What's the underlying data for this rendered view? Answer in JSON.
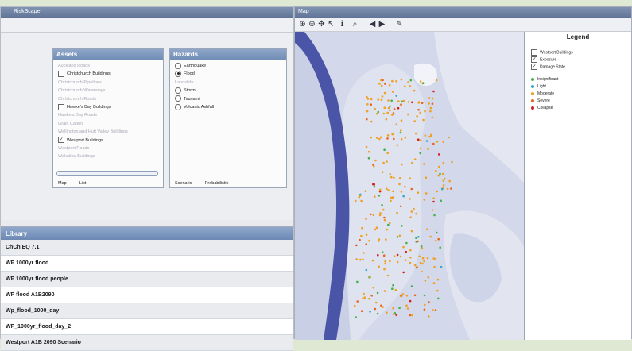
{
  "left_window": {
    "title": "RiskScape"
  },
  "assets": {
    "title": "Assets",
    "items": [
      {
        "label": "Auckland Roads",
        "checked": false,
        "enabled": false
      },
      {
        "label": "Christchurch Buildings",
        "checked": false,
        "enabled": true
      },
      {
        "label": "Christchurch Pipelines",
        "checked": false,
        "enabled": false
      },
      {
        "label": "Christchurch Waterways",
        "checked": false,
        "enabled": false
      },
      {
        "label": "Christchurch Roads",
        "checked": false,
        "enabled": false
      },
      {
        "label": "Hawke's Bay Buildings",
        "checked": false,
        "enabled": true
      },
      {
        "label": "Hawke's Bay Roads",
        "checked": false,
        "enabled": false
      },
      {
        "label": "Grain Cables",
        "checked": false,
        "enabled": false
      },
      {
        "label": "Wellington and Hutt Valley Buildings",
        "checked": false,
        "enabled": false
      },
      {
        "label": "Westport Buildings",
        "checked": true,
        "enabled": true
      },
      {
        "label": "Westport Roads",
        "checked": false,
        "enabled": false
      },
      {
        "label": "Wakatipu Buildings",
        "checked": false,
        "enabled": false
      }
    ],
    "footer": [
      "Map",
      "List"
    ]
  },
  "hazards": {
    "title": "Hazards",
    "items": [
      {
        "label": "Earthquake",
        "selected": false,
        "enabled": true
      },
      {
        "label": "Flood",
        "selected": true,
        "enabled": true
      },
      {
        "label": "Landslide",
        "selected": false,
        "enabled": false
      },
      {
        "label": "Storm",
        "selected": false,
        "enabled": true
      },
      {
        "label": "Tsunami",
        "selected": false,
        "enabled": true
      },
      {
        "label": "Volcanic Ashfall",
        "selected": false,
        "enabled": true
      }
    ],
    "footer": [
      "Scenario",
      "Probabilistic"
    ]
  },
  "library": {
    "title": "Library",
    "items": [
      "ChCh EQ 7.1",
      "WP 1000yr flood",
      "WP 1000yr flood people",
      "WP flood A1B2090",
      "Wp_flood_1000_day",
      "WP_1000yr_flood_day_2",
      "Westport A1B 2090 Scenario"
    ]
  },
  "map_window": {
    "title": "Map"
  },
  "legend": {
    "title": "Legend",
    "layers": [
      {
        "label": "Westport Buildings",
        "checked": false
      },
      {
        "label": "Exposure",
        "checked": true
      },
      {
        "label": "Damage State",
        "checked": true
      }
    ],
    "classes": [
      {
        "label": "Insignificant",
        "color": "#43b04a"
      },
      {
        "label": "Light",
        "color": "#31a8c9"
      },
      {
        "label": "Moderate",
        "color": "#f0a020"
      },
      {
        "label": "Severe",
        "color": "#e8641e"
      },
      {
        "label": "Collapse",
        "color": "#d42020"
      }
    ]
  },
  "icons": {
    "map_tools": [
      "zoom-in-icon",
      "zoom-out-icon",
      "pan-icon",
      "select-arrow-icon",
      "info-icon",
      "zoom-extent-icon",
      "back-arrow-icon",
      "forward-arrow-icon",
      "draw-pen-icon"
    ],
    "tool_glyphs": [
      "⊕",
      "⊖",
      "✥",
      "↖",
      "ℹ",
      "⌕",
      "◀",
      "▶",
      "✎"
    ]
  }
}
